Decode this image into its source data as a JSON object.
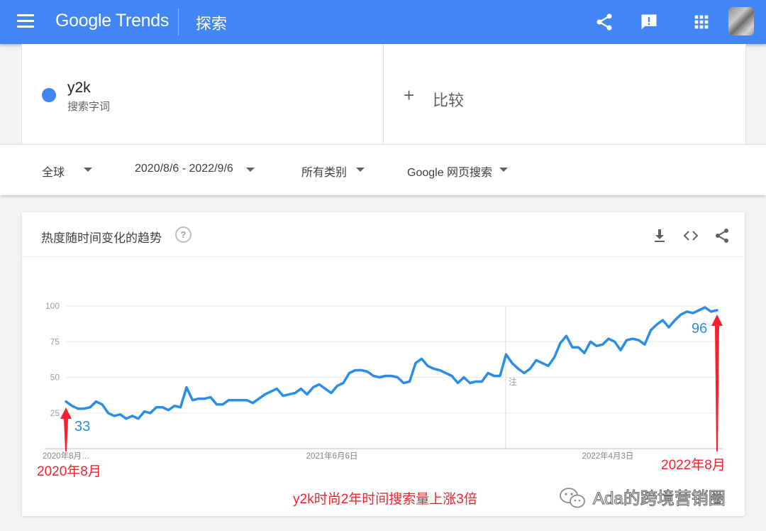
{
  "header": {
    "app_name": "Google Trends",
    "section": "探索",
    "icons": [
      "menu-icon",
      "share-icon",
      "feedback-icon",
      "apps-grid-icon"
    ]
  },
  "terms": {
    "term1": {
      "name": "y2k",
      "type": "搜索字词",
      "color": "#4285f4"
    },
    "compare_label": "比较"
  },
  "filters": {
    "region": "全球",
    "date_range": "2020/8/6 - 2022/9/6",
    "category": "所有类别",
    "search_type": "Google 网页搜索"
  },
  "chart_card": {
    "title": "热度随时间变化的趋势",
    "help": "?",
    "icons": [
      "download-icon",
      "embed-icon",
      "share-icon"
    ]
  },
  "chart_data": {
    "type": "line",
    "x_start": "2020年8月…",
    "x_tick_labels": [
      "2020年8月…",
      "2021年6月6日",
      "2022年4月3日"
    ],
    "y_ticks": [
      25,
      50,
      75,
      100
    ],
    "ylim": [
      0,
      100
    ],
    "grid": true,
    "line_color": "#2b8de6",
    "values": [
      33,
      30,
      28,
      28,
      29,
      33,
      31,
      25,
      23,
      24,
      21,
      23,
      21,
      26,
      25,
      29,
      29,
      27,
      30,
      29,
      43,
      34,
      35,
      35,
      36,
      31,
      31,
      34,
      34,
      34,
      34,
      32,
      35,
      38,
      40,
      42,
      37,
      38,
      39,
      42,
      38,
      43,
      45,
      42,
      39,
      44,
      46,
      53,
      55,
      55,
      54,
      51,
      50,
      51,
      51,
      50,
      46,
      47,
      60,
      63,
      58,
      56,
      55,
      53,
      51,
      46,
      50,
      46,
      47,
      47,
      53,
      51,
      51,
      66,
      60,
      56,
      53,
      56,
      62,
      60,
      58,
      64,
      74,
      79,
      71,
      71,
      67,
      75,
      72,
      73,
      77,
      75,
      69,
      76,
      77,
      76,
      73,
      83,
      87,
      90,
      85,
      90,
      94,
      96,
      95,
      97,
      99,
      96,
      97
    ],
    "annotation_note": "注",
    "start_value_label": "33",
    "end_value_label": "96",
    "start_date_label": "2020年8月",
    "end_date_label": "2022年8月",
    "caption": "y2k时尚2年时间搜索量上涨3倍"
  },
  "watermark": "Ada的跨境营销圈",
  "colors": {
    "brand": "#4285f4",
    "annotation_red": "#f5222d",
    "series_blue": "#2b8de6"
  }
}
